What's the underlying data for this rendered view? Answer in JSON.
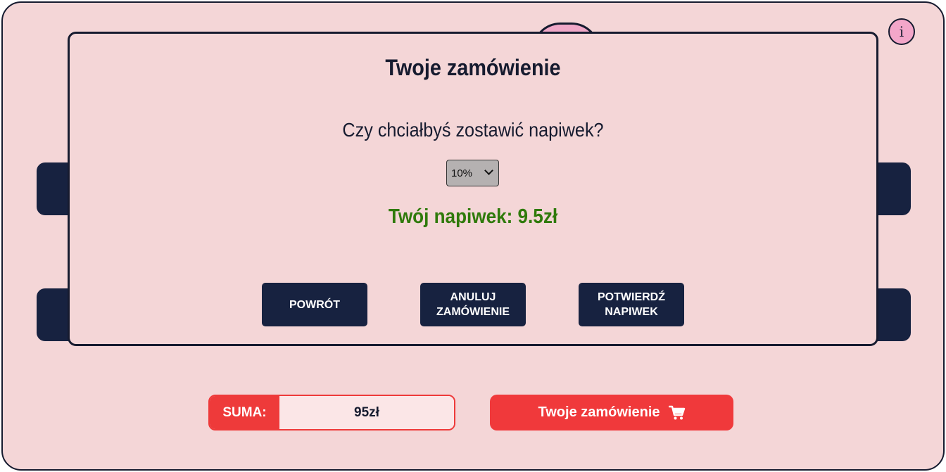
{
  "modal": {
    "title": "Twoje zamówienie",
    "question": "Czy chciałbyś zostawić napiwek?",
    "tip_select": {
      "selected": "10%"
    },
    "tip_amount": "Twój napiwek: 9.5zł",
    "buttons": {
      "back": "POWRÓT",
      "cancel_line1": "ANULUJ",
      "cancel_line2": "ZAMÓWIENIE",
      "confirm_line1": "POTWIERDŹ",
      "confirm_line2": "NAPIWEK"
    }
  },
  "footer": {
    "sum_label": "SUMA:",
    "sum_value": "95zł",
    "order_button_label": "Twoje zamówienie"
  },
  "icons": {
    "info": "info-icon",
    "cart": "cart-icon",
    "chevron": "chevron-down-icon"
  },
  "colors": {
    "background": "#f4d6d7",
    "navy": "#172240",
    "red": "#f0393b",
    "tip_green": "#2f7a0b",
    "info_pink": "#f3a6c9"
  }
}
